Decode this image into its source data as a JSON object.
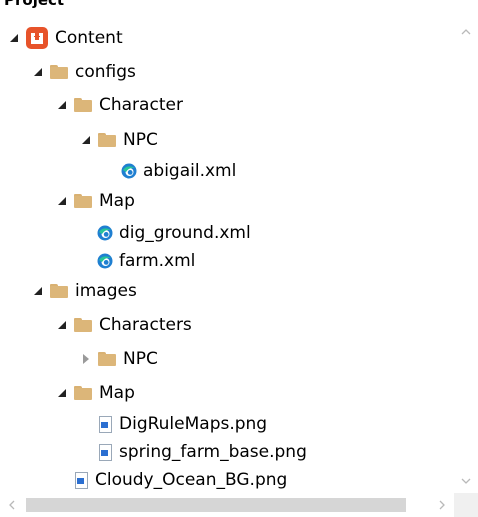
{
  "panel": {
    "title": "Project"
  },
  "tree": [
    {
      "label": "Content",
      "icon": "monogame-icon",
      "expander": "open"
    },
    {
      "label": "configs",
      "icon": "folder-icon",
      "expander": "open"
    },
    {
      "label": "Character",
      "icon": "folder-icon",
      "expander": "open"
    },
    {
      "label": "NPC",
      "icon": "folder-icon",
      "expander": "open"
    },
    {
      "label": "abigail.xml",
      "icon": "xml-file-icon",
      "expander": "none"
    },
    {
      "label": "Map",
      "icon": "folder-icon",
      "expander": "open"
    },
    {
      "label": "dig_ground.xml",
      "icon": "xml-file-icon",
      "expander": "none"
    },
    {
      "label": "farm.xml",
      "icon": "xml-file-icon",
      "expander": "none"
    },
    {
      "label": "images",
      "icon": "folder-icon",
      "expander": "open"
    },
    {
      "label": "Characters",
      "icon": "folder-icon",
      "expander": "open"
    },
    {
      "label": "NPC",
      "icon": "folder-icon",
      "expander": "closed"
    },
    {
      "label": "Map",
      "icon": "folder-icon",
      "expander": "open"
    },
    {
      "label": "DigRuleMaps.png",
      "icon": "png-file-icon",
      "expander": "none"
    },
    {
      "label": "spring_farm_base.png",
      "icon": "png-file-icon",
      "expander": "none"
    },
    {
      "label": "Cloudy_Ocean_BG.png",
      "icon": "png-file-icon",
      "expander": "none"
    }
  ],
  "colors": {
    "folder": "#dcb679",
    "monogame": "#e7532a",
    "xml": "#1f7fd1",
    "scrollbar_thumb": "#d6d6d6"
  }
}
